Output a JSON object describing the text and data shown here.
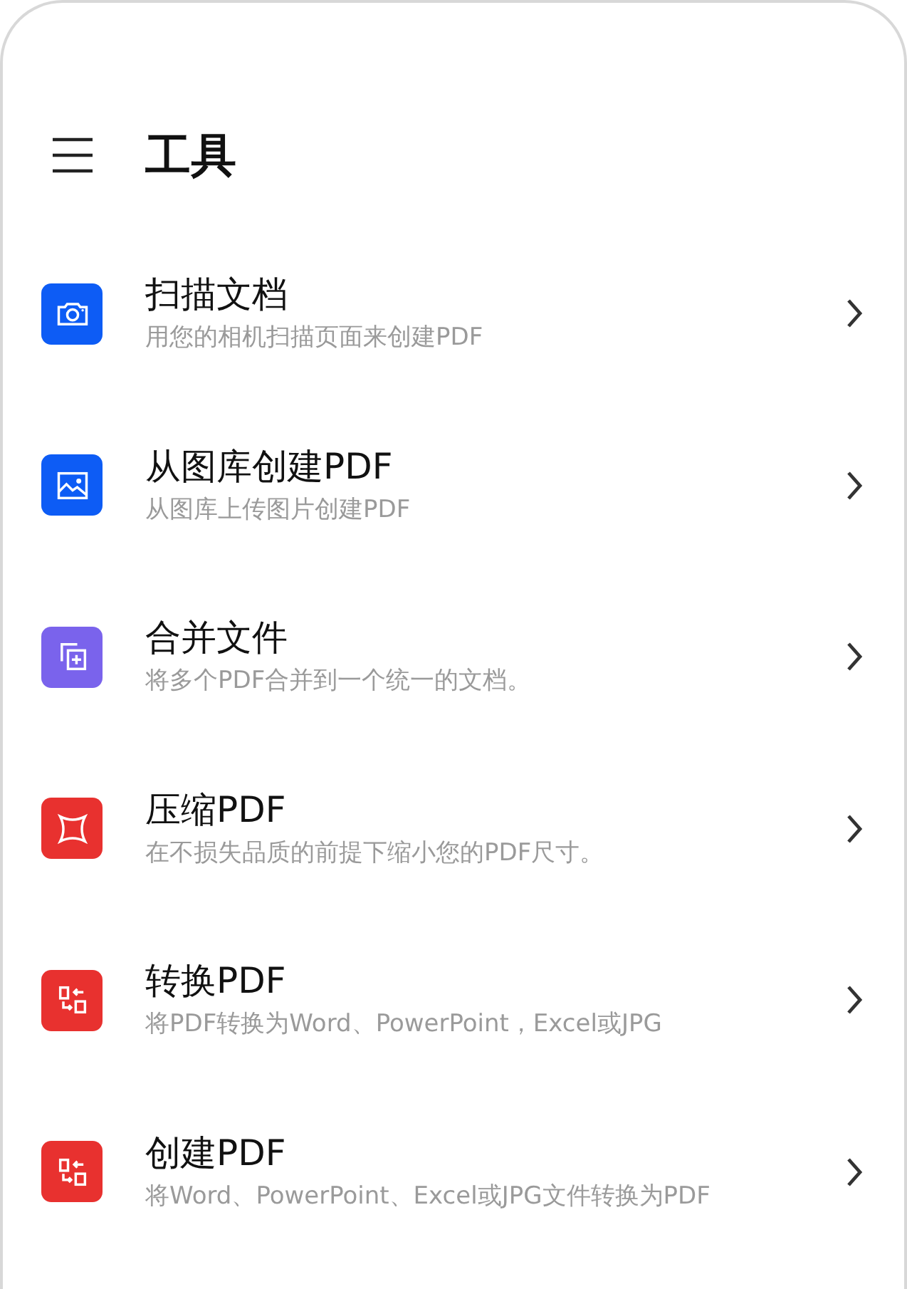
{
  "header": {
    "title": "工具"
  },
  "tools": [
    {
      "kind": "camera",
      "color": "#0d5cf5",
      "title": "扫描文档",
      "subtitle": "用您的相机扫描页面来创建PDF"
    },
    {
      "kind": "gallery",
      "color": "#0d5cf5",
      "title": "从图库创建PDF",
      "subtitle": "从图库上传图片创建PDF"
    },
    {
      "kind": "merge",
      "color": "#7a63ec",
      "title": "合并文件",
      "subtitle": "将多个PDF合并到一个统一的文档。"
    },
    {
      "kind": "compress",
      "color": "#e8312f",
      "title": "压缩PDF",
      "subtitle": "在不损失品质的前提下缩小您的PDF尺寸。"
    },
    {
      "kind": "convert",
      "color": "#e8312f",
      "title": "转换PDF",
      "subtitle": "将PDF转换为Word、PowerPoint，Excel或JPG"
    },
    {
      "kind": "convert",
      "color": "#e8312f",
      "title": "创建PDF",
      "subtitle": "将Word、PowerPoint、Excel或JPG文件转换为PDF"
    }
  ]
}
